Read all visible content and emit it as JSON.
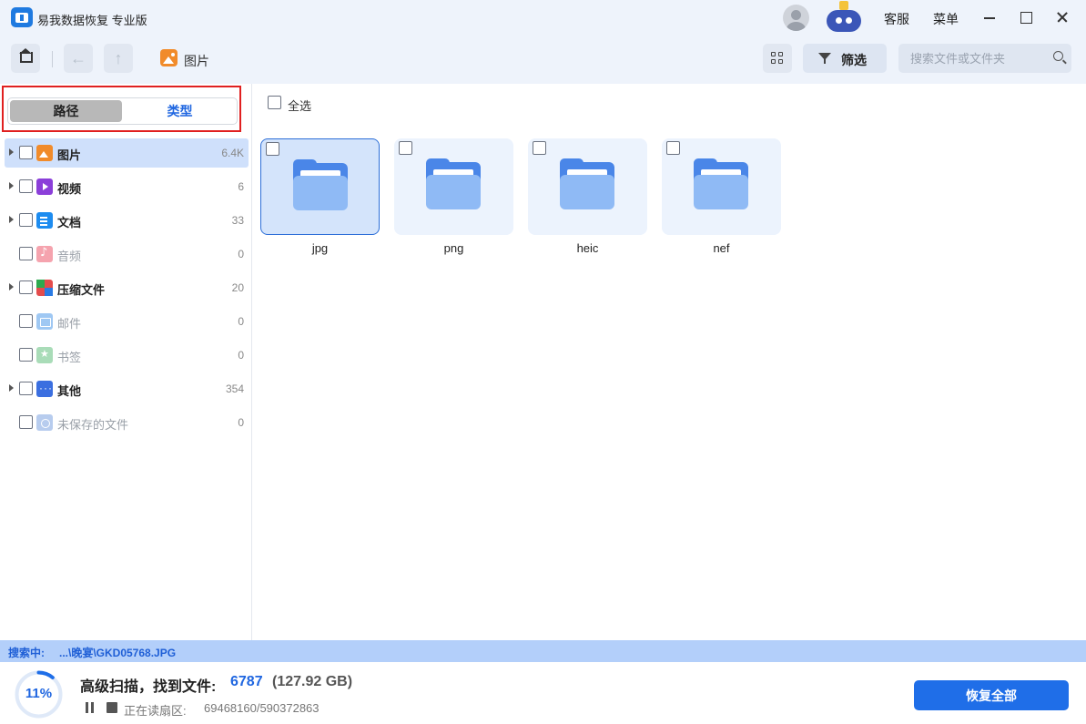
{
  "window": {
    "title": "易我数据恢复 专业版",
    "support_label": "客服",
    "menu_label": "菜单"
  },
  "toolbar": {
    "breadcrumb_label": "图片",
    "filter_label": "筛选",
    "search_placeholder": "搜索文件或文件夹"
  },
  "sidebar": {
    "tabs": [
      {
        "label": "路径",
        "active": false
      },
      {
        "label": "类型",
        "active": true
      }
    ],
    "items": [
      {
        "label": "图片",
        "count": "6.4K",
        "icon": "image-icon",
        "expandable": true,
        "active": true
      },
      {
        "label": "视频",
        "count": "6",
        "icon": "video-icon",
        "expandable": true
      },
      {
        "label": "文档",
        "count": "33",
        "icon": "document-icon",
        "expandable": true
      },
      {
        "label": "音频",
        "count": "0",
        "icon": "audio-icon",
        "expandable": false
      },
      {
        "label": "压缩文件",
        "count": "20",
        "icon": "archive-icon",
        "expandable": true
      },
      {
        "label": "邮件",
        "count": "0",
        "icon": "mail-icon",
        "expandable": false
      },
      {
        "label": "书签",
        "count": "0",
        "icon": "bookmark-icon",
        "expandable": false
      },
      {
        "label": "其他",
        "count": "354",
        "icon": "other-icon",
        "expandable": true
      },
      {
        "label": "未保存的文件",
        "count": "0",
        "icon": "unsaved-file-icon",
        "expandable": false
      }
    ]
  },
  "main": {
    "select_all_label": "全选",
    "folders": [
      {
        "name": "jpg",
        "selected": true
      },
      {
        "name": "png"
      },
      {
        "name": "heic"
      },
      {
        "name": "nef"
      }
    ]
  },
  "status": {
    "searching_label": "搜索中:",
    "current_path": "...\\晚宴\\GKD05768.JPG"
  },
  "footer": {
    "progress_percent": 11,
    "progress_label": "11%",
    "scan_title": "高级扫描，找到文件:",
    "found_count": "6787",
    "found_size": "(127.92 GB)",
    "sector_label": "正在读扇区:",
    "sector_value": "69468160/590372863",
    "recover_all_label": "恢复全部"
  },
  "colors": {
    "accent": "#1f6ee8",
    "selection_bg": "#cfe0fb",
    "status_bar_bg": "#b3cffa",
    "highlight_border": "#e02020"
  }
}
